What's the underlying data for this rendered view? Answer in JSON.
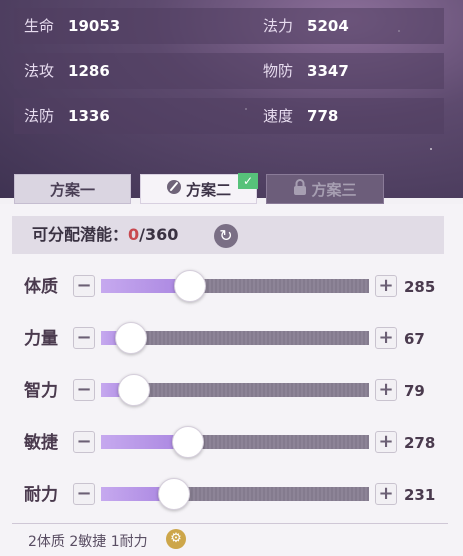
{
  "stats": [
    [
      {
        "label": "生命",
        "value": "19053"
      },
      {
        "label": "法力",
        "value": "5204"
      }
    ],
    [
      {
        "label": "法攻",
        "value": "1286"
      },
      {
        "label": "物防",
        "value": "3347"
      }
    ],
    [
      {
        "label": "法防",
        "value": "1336"
      },
      {
        "label": "速度",
        "value": "778"
      }
    ]
  ],
  "tabs": [
    {
      "label": "方案一",
      "state": "normal"
    },
    {
      "label": "方案二",
      "state": "selected",
      "icon": "brush-icon",
      "badge": "✓"
    },
    {
      "label": "方案三",
      "state": "locked",
      "icon": "lock-icon"
    }
  ],
  "potential": {
    "label": "可分配潜能：",
    "current": "0",
    "total": "/360"
  },
  "attributes": [
    {
      "name": "体质",
      "value": "285",
      "level": 0.33
    },
    {
      "name": "力量",
      "value": "67",
      "level": 0.11
    },
    {
      "name": "智力",
      "value": "79",
      "level": 0.12
    },
    {
      "name": "敏捷",
      "value": "278",
      "level": 0.32
    },
    {
      "name": "耐力",
      "value": "231",
      "level": 0.27
    }
  ],
  "controls": {
    "minus": "−",
    "plus": "+",
    "reset_icon": "↻",
    "gear_icon": "⚙"
  },
  "recommend": "2体质 2敏捷 1耐力",
  "colors": {
    "fill": "#b393e6",
    "track": "#8a8194",
    "current_potential": "#c8484f"
  }
}
